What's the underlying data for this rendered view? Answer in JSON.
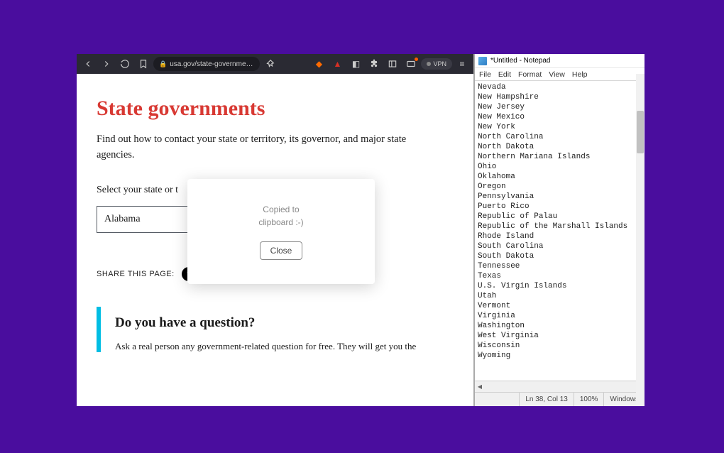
{
  "browser": {
    "url_display": "usa.gov/state-governme…",
    "vpn_label": "VPN"
  },
  "page": {
    "title": "State governments",
    "subtitle": "Find out how to contact your state or territory, its governor, and major state agencies.",
    "select_label": "Select your state or t",
    "selected_state": "Alabama",
    "share_label": "SHARE THIS PAGE:",
    "question_heading": "Do you have a question?",
    "question_body": "Ask a real person any government-related question for free. They will get you the"
  },
  "popup": {
    "message_line1": "Copied to",
    "message_line2": "clipboard :-)",
    "close_label": "Close"
  },
  "notepad": {
    "title": "*Untitled - Notepad",
    "menu": {
      "file": "File",
      "edit": "Edit",
      "format": "Format",
      "view": "View",
      "help": "Help"
    },
    "lines": [
      "Nevada",
      "New Hampshire",
      "New Jersey",
      "New Mexico",
      "New York",
      "North Carolina",
      "North Dakota",
      "Northern Mariana Islands",
      "Ohio",
      "Oklahoma",
      "Oregon",
      "Pennsylvania",
      "Puerto Rico",
      "Republic of Palau",
      "Republic of the Marshall Islands",
      "Rhode Island",
      "South Carolina",
      "South Dakota",
      "Tennessee",
      "Texas",
      "U.S. Virgin Islands",
      "Utah",
      "Vermont",
      "Virginia",
      "Washington",
      "West Virginia",
      "Wisconsin",
      "Wyoming"
    ],
    "status": {
      "pos": "Ln 38, Col 13",
      "zoom": "100%",
      "enc": "Windows"
    }
  }
}
